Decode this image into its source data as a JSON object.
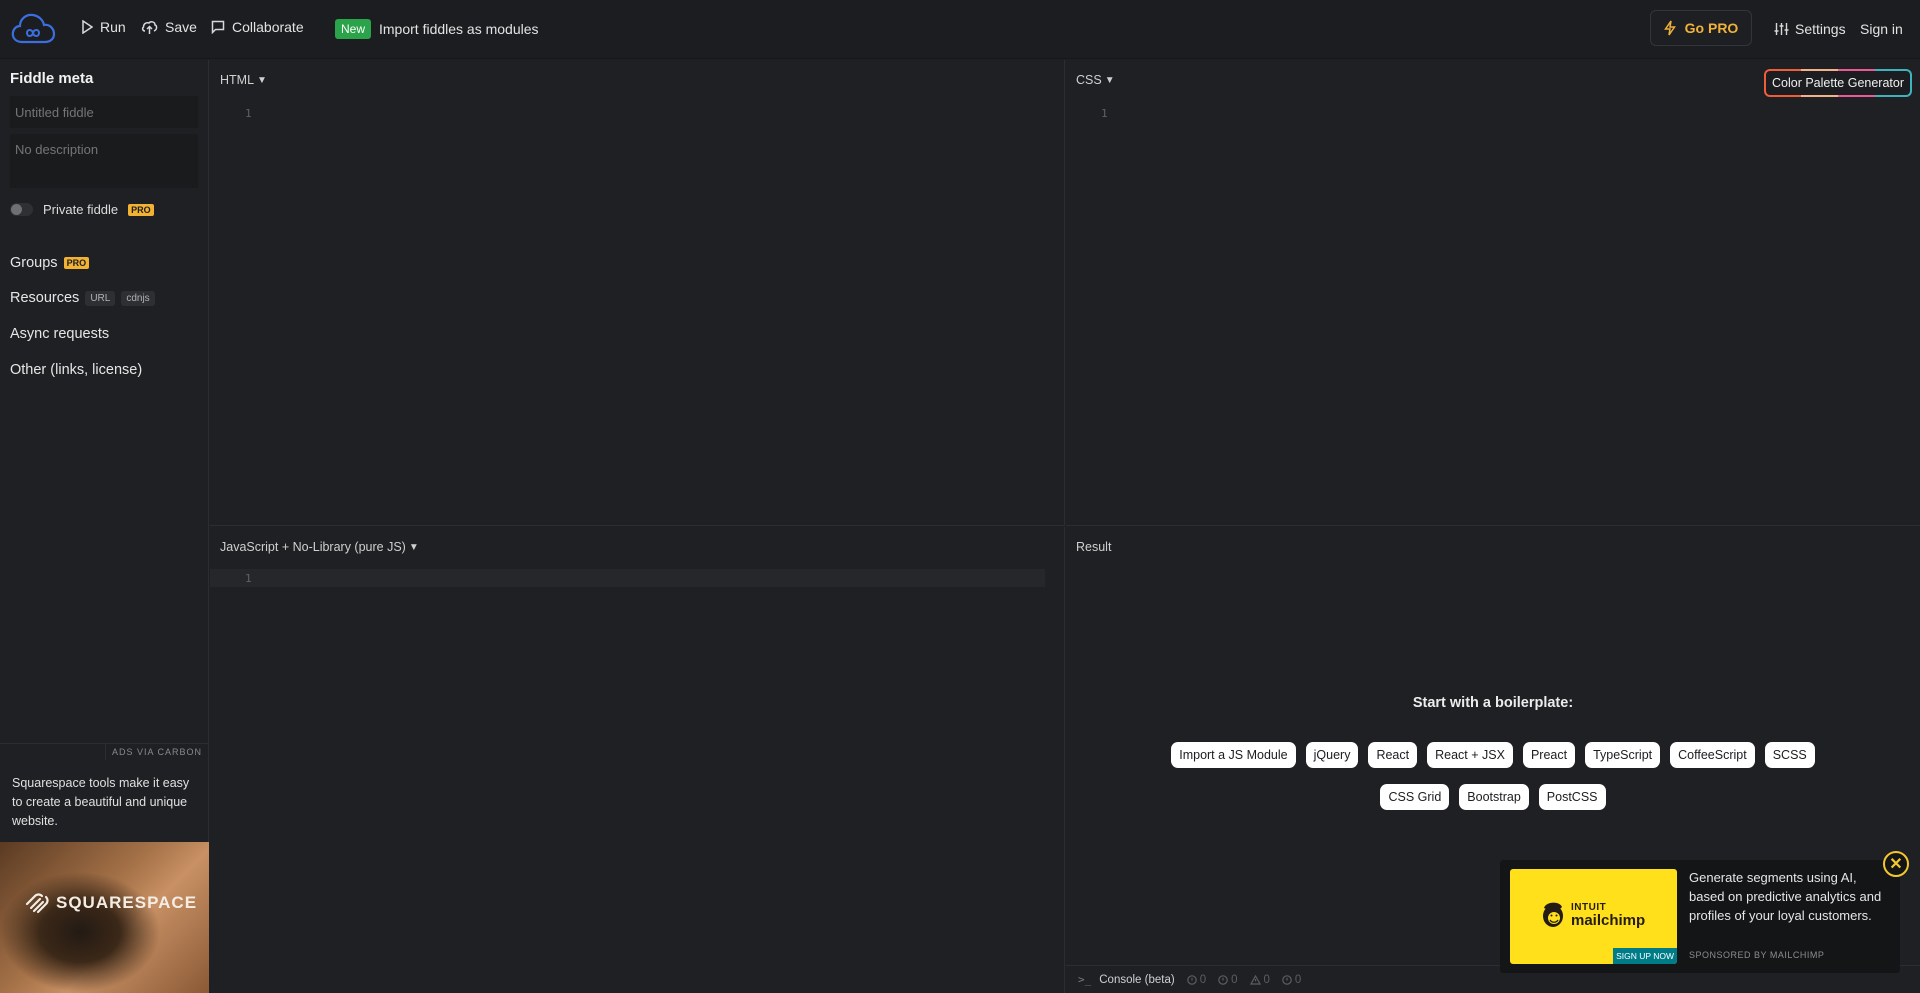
{
  "header": {
    "logo": "jsfiddle-cloud-logo",
    "run_label": "Run",
    "save_label": "Save",
    "collaborate_label": "Collaborate",
    "new_badge": "New",
    "import_label": "Import fiddles as modules",
    "gopro_label": "Go PRO",
    "settings_label": "Settings",
    "signin_label": "Sign in"
  },
  "sidebar": {
    "title": "Fiddle meta",
    "title_placeholder": "Untitled fiddle",
    "description_placeholder": "No description",
    "private_label": "Private fiddle",
    "pro_badge": "PRO",
    "private_enabled": false,
    "items": [
      {
        "label": "Groups",
        "badge": "PRO"
      },
      {
        "label": "Resources",
        "tags": [
          "URL",
          "cdnjs"
        ]
      },
      {
        "label": "Async requests"
      },
      {
        "label": "Other (links, license)"
      }
    ],
    "ads_label": "ADS VIA CARBON",
    "ad_text": "Squarespace tools make it easy to create a beautiful and unique website.",
    "ad_brand": "SQUARESPACE"
  },
  "panels": {
    "html": {
      "label": "HTML",
      "line": "1"
    },
    "css": {
      "label": "CSS",
      "line": "1",
      "palette_button": "Color Palette Generator"
    },
    "js": {
      "label": "JavaScript + No-Library (pure JS)",
      "line": "1"
    },
    "result": {
      "label": "Result"
    }
  },
  "boilerplate": {
    "title": "Start with a boilerplate:",
    "row1": [
      "Import a JS Module",
      "jQuery",
      "React",
      "React + JSX",
      "Preact",
      "TypeScript",
      "CoffeeScript",
      "SCSS"
    ],
    "row2": [
      "CSS Grid",
      "Bootstrap",
      "PostCSS"
    ]
  },
  "console": {
    "label": "Console (beta)",
    "counts": [
      "0",
      "0",
      "0",
      "0"
    ]
  },
  "mailchimp_ad": {
    "intuit": "INTUIT",
    "brand": "mailchimp",
    "cta": "SIGN UP NOW",
    "text": "Generate segments using AI, based on predictive analytics and profiles of your loyal customers.",
    "sponsored": "SPONSORED BY MAILCHIMP"
  },
  "colors": {
    "accent_logo": "#3b6fe0",
    "pro_yellow": "#f2b233",
    "new_green": "#2aa34a",
    "mailchimp_yellow": "#ffe01b",
    "mailchimp_teal": "#007c89"
  }
}
